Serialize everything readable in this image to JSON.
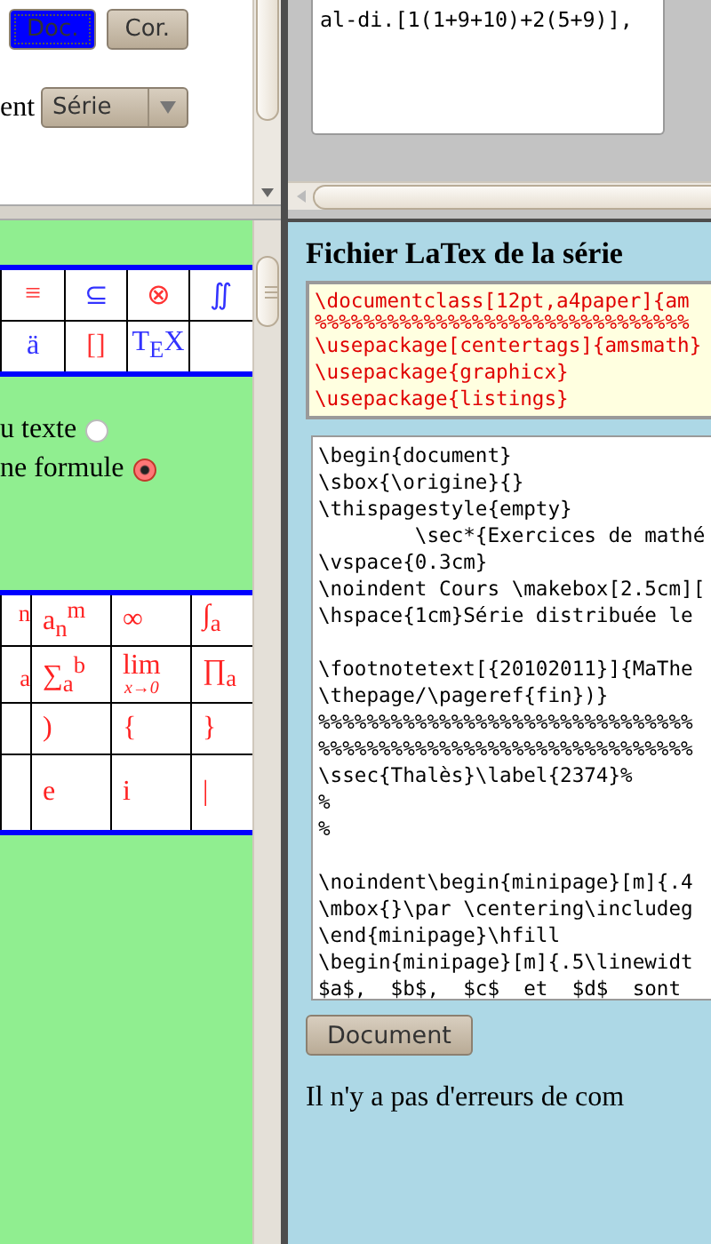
{
  "left_top": {
    "buttons": [
      {
        "label": "Doc.",
        "selected": true
      },
      {
        "label": "Cor.",
        "selected": false
      }
    ],
    "select": {
      "label": "ent",
      "value": "Série"
    }
  },
  "symbols_table": {
    "rows": [
      [
        {
          "text": "≡",
          "color": "#ff3333"
        },
        {
          "text": "⊆",
          "color": "#3333ff"
        },
        {
          "text": "⊗",
          "color": "#ff3333"
        },
        {
          "text": "∬",
          "color": "#3333ff"
        }
      ],
      [
        {
          "text": "ä",
          "color": "#3333ff"
        },
        {
          "text": "[]",
          "color": "#ff3333"
        },
        {
          "text": "T$_{E}$X",
          "color": "#3333ff"
        },
        null
      ]
    ]
  },
  "insert_options": [
    {
      "label": "u texte",
      "selected": false
    },
    {
      "label": "ne formule",
      "selected": true
    }
  ],
  "formula_table": {
    "rows": [
      [
        {
          "text": "$^{n}$"
        },
        {
          "text": "a$_{n}$$^{m}$"
        },
        {
          "text": "∞"
        },
        {
          "text": "∫$_{a}$"
        }
      ],
      [
        {
          "text": "$_{a}$"
        },
        {
          "text": "∑$_{a}$$^{b}$"
        },
        {
          "text": "lim",
          "under": "x→0"
        },
        {
          "text": "∏$_{a}$"
        }
      ],
      [
        null,
        {
          "text": ")"
        },
        {
          "text": "{"
        },
        {
          "text": "}"
        }
      ],
      [
        null,
        {
          "text": "e"
        },
        {
          "text": "i"
        },
        {
          "text": "|"
        }
      ]
    ]
  },
  "top_editor": {
    "value": "al-di.[1(1+9+10)+2(5+9)],"
  },
  "latex": {
    "title": "Fichier LaTex de la série",
    "preamble": [
      "\\documentclass[12pt,a4paper]{am",
      "%%%%%%%%%%%%%%%%%%%%%%%%%%%%%%%",
      "\\usepackage[centertags]{amsmath}",
      "\\usepackage{graphicx}",
      "\\usepackage{listings}"
    ],
    "body": [
      [
        "\\begin{document}",
        "\\sbox{\\origine}{}",
        "\\thispagestyle{empty}",
        "        \\sec*{Exercices de mathé",
        "\\vspace{0.3cm}",
        "\\noindent Cours \\makebox[2.5cm][",
        "\\hspace{1cm}Série distribuée le"
      ],
      [
        "\\footnotetext[{20102011}]{MaThe",
        "\\thepage/\\pageref{fin})}",
        "%%%%%%%%%%%%%%%%%%%%%%%%%%%%%%%",
        "%%%%%%%%%%%%%%%%%%%%%%%%%%%%%%%",
        "\\ssec{Thalès}\\label{2374}%",
        "%",
        "%"
      ],
      [
        "\\noindent\\begin{minipage}[m]{.4",
        "\\mbox{}\\par \\centering\\includeg",
        "\\end{minipage}\\hfill",
        "\\begin{minipage}[m]{.5\\linewidt",
        "$a$,  $b$,  $c$  et  $d$  sont"
      ]
    ],
    "button": "Document",
    "message": "Il n'y a pas d'erreurs de com"
  }
}
